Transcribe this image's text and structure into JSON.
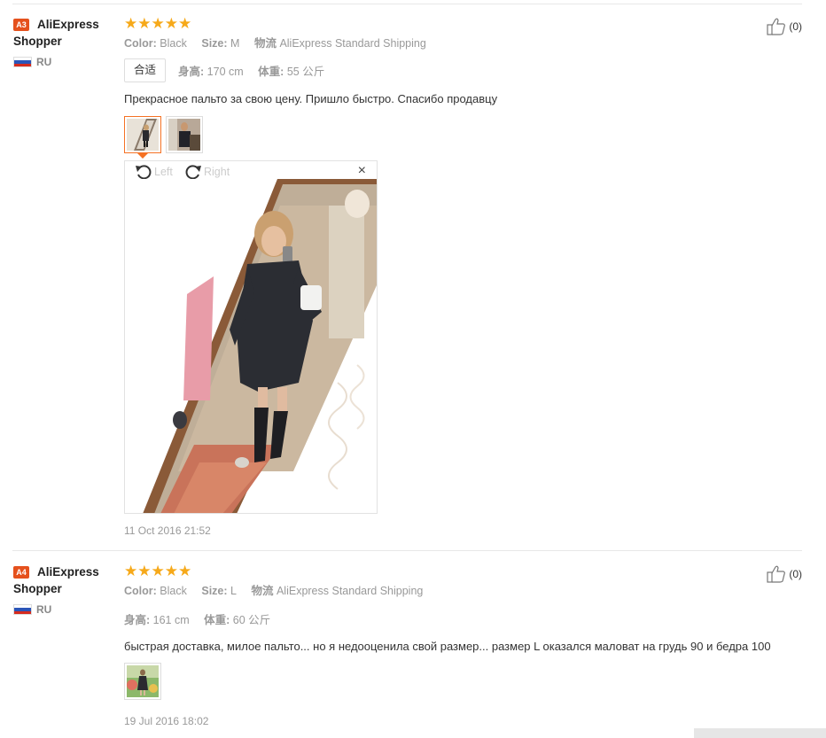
{
  "labels": {
    "color": "Color:",
    "size": "Size:",
    "shipping": "物流",
    "height": "身高:",
    "weight": "体重:"
  },
  "reviews": [
    {
      "level": "A3",
      "name_line1": "AliExpress",
      "name_line2": "Shopper",
      "country": "RU",
      "stars": "★★★★★",
      "color": "Black",
      "size": "M",
      "shipping": "AliExpress Standard Shipping",
      "fit": "合适",
      "height": "170 cm",
      "weight": "55 公斤",
      "text": "Прекрасное пальто за свою цену. Пришло быстро. Спасибо продавцу",
      "viewer": {
        "left_label": "Left",
        "right_label": "Right",
        "close": "×"
      },
      "date": "11 Oct 2016 21:52",
      "likes": "(0)"
    },
    {
      "level": "A4",
      "name_line1": "AliExpress",
      "name_line2": "Shopper",
      "country": "RU",
      "stars": "★★★★★",
      "color": "Black",
      "size": "L",
      "shipping": "AliExpress Standard Shipping",
      "height": "161 cm",
      "weight": "60 公斤",
      "text": "быстрая доставка, милое пальто... но я недооценила свой размер... размер L оказался маловат на грудь 90 и бедра 100",
      "date": "19 Jul 2016 18:02",
      "likes": "(0)"
    }
  ],
  "colors": {
    "star": "#f6a91a",
    "badge": "#e5511d",
    "active_thumb": "#f57224"
  }
}
